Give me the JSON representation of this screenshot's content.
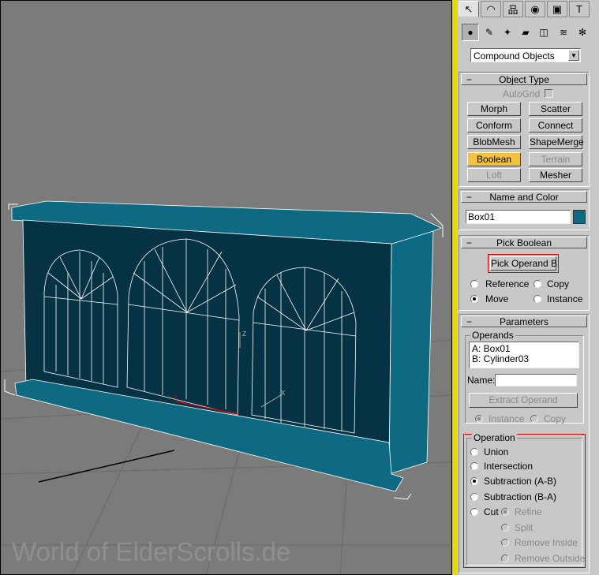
{
  "viewport": {
    "watermark": "World of ElderScrolls.de",
    "axis_labels": {
      "z": "Z",
      "x": "X"
    }
  },
  "command_panel": {
    "tabs": [
      {
        "name": "create-tab",
        "glyph": "↖",
        "active": true
      },
      {
        "name": "modify-tab",
        "glyph": "◠",
        "active": false
      },
      {
        "name": "hierarchy-tab",
        "glyph": "品",
        "active": false
      },
      {
        "name": "motion-tab",
        "glyph": "◉",
        "active": false
      },
      {
        "name": "display-tab",
        "glyph": "▣",
        "active": false
      },
      {
        "name": "utilities-tab",
        "glyph": "T",
        "active": false
      }
    ],
    "create_categories": [
      {
        "name": "geometry-icon",
        "glyph": "●",
        "active": true
      },
      {
        "name": "shapes-icon",
        "glyph": "✎",
        "active": false
      },
      {
        "name": "lights-icon",
        "glyph": "✦",
        "active": false
      },
      {
        "name": "cameras-icon",
        "glyph": "▰",
        "active": false
      },
      {
        "name": "helpers-icon",
        "glyph": "◫",
        "active": false
      },
      {
        "name": "spacewarps-icon",
        "glyph": "≋",
        "active": false
      },
      {
        "name": "systems-icon",
        "glyph": "✻",
        "active": false
      }
    ],
    "category_dropdown": "Compound Objects"
  },
  "object_type": {
    "title": "Object Type",
    "autogrid_label": "AutoGrid",
    "buttons": [
      {
        "label": "Morph",
        "state": "normal"
      },
      {
        "label": "Scatter",
        "state": "normal"
      },
      {
        "label": "Conform",
        "state": "normal"
      },
      {
        "label": "Connect",
        "state": "normal"
      },
      {
        "label": "BlobMesh",
        "state": "normal"
      },
      {
        "label": "ShapeMerge",
        "state": "normal"
      },
      {
        "label": "Boolean",
        "state": "active"
      },
      {
        "label": "Terrain",
        "state": "disabled"
      },
      {
        "label": "Loft",
        "state": "disabled"
      },
      {
        "label": "Mesher",
        "state": "normal"
      }
    ]
  },
  "name_and_color": {
    "title": "Name and Color",
    "name_value": "Box01",
    "color": "#0e6a82"
  },
  "pick_boolean": {
    "title": "Pick Boolean",
    "pick_button": "Pick Operand B",
    "options": {
      "reference": "Reference",
      "copy": "Copy",
      "move": "Move",
      "instance": "Instance"
    },
    "selected": "Move"
  },
  "parameters": {
    "title": "Parameters",
    "operands_label": "Operands",
    "operands": [
      "A: Box01",
      "B: Cylinder03"
    ],
    "name_label": "Name:",
    "name_value": "",
    "extract_button": "Extract Operand",
    "instance_label": "Instance",
    "copy_label": "Copy",
    "operation_label": "Operation",
    "operations": [
      "Union",
      "Intersection",
      "Subtraction (A-B)",
      "Subtraction (B-A)"
    ],
    "selected_operation": "Subtraction (A-B)",
    "cut_label": "Cut",
    "cut_options": [
      "Refine",
      "Split",
      "Remove Inside",
      "Remove Outside"
    ],
    "selected_cut_option": "Refine"
  },
  "colors": {
    "viewport_bg": "#7b7b7b",
    "model_face": "#063344",
    "model_side": "#0e6a82",
    "active_button": "#f4c23e",
    "highlight_red": "#e00000",
    "yellow_frame": "#e9d900"
  }
}
